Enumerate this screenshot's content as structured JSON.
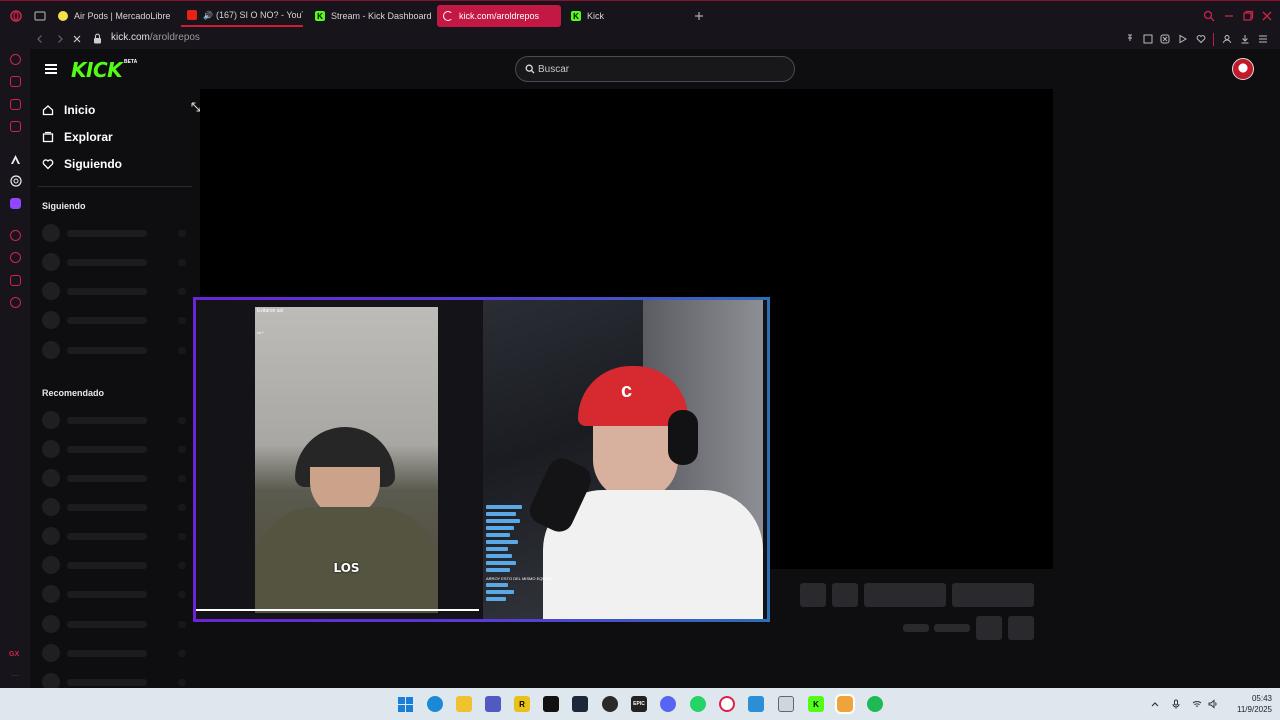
{
  "browser": {
    "tabs": [
      {
        "label": "Air Pods | MercadoLibre",
        "state": "normal"
      },
      {
        "label": "(167) SI O NO? - YouT",
        "state": "playing"
      },
      {
        "label": "Stream - Kick Dashboard",
        "state": "normal"
      },
      {
        "label": "kick.com/aroldrepos",
        "state": "active"
      },
      {
        "label": "Kick",
        "state": "normal"
      }
    ],
    "address": {
      "domain": "kick.com",
      "path": "/aroldrepos"
    }
  },
  "kick": {
    "logo": "KICK",
    "logo_badge": "BETA",
    "search_placeholder": "Buscar",
    "nav": [
      {
        "label": "Inicio",
        "icon": "home-icon"
      },
      {
        "label": "Explorar",
        "icon": "browse-icon"
      },
      {
        "label": "Siguiendo",
        "icon": "heart-icon"
      }
    ],
    "following_title": "Siguiendo",
    "recommended_title": "Recomendado"
  },
  "stream_overlay": {
    "caption": "LOS",
    "phone_top_text": "Evitaron así",
    "phone_sub_text": "co?",
    "chat_highlight": "ARROY ESTO DEL MISMO EQUIPO"
  },
  "taskbar": {
    "time": "05:43",
    "date": "11/9/2025"
  },
  "colors": {
    "kick_green": "#53fc18",
    "opera_red": "#c41844",
    "pip_border_start": "#6b24d8",
    "pip_border_end": "#2b6fb8"
  }
}
